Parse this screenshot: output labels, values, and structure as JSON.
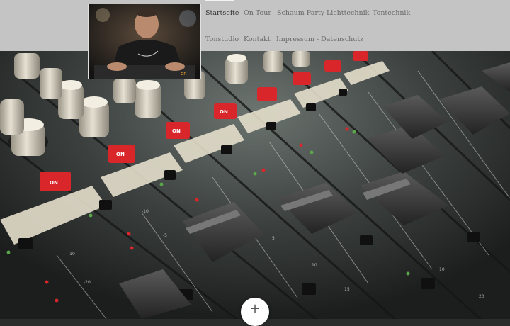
{
  "nav": {
    "items": [
      {
        "label": "Startseite",
        "active": true
      },
      {
        "label": "On Tour"
      },
      {
        "label": "Schaum Party"
      },
      {
        "label": "Lichttechnik"
      },
      {
        "label": "Tontechnik"
      },
      {
        "label": "Tonstudio"
      },
      {
        "label": "Kontakt"
      },
      {
        "label": "Impressum - Datenschutz"
      }
    ]
  },
  "logo": {
    "alt": "DJ portrait at mixing desk"
  },
  "hero": {
    "alt": "Close-up of an audio mixing console"
  },
  "fab": {
    "icon": "plus-icon",
    "symbol": "+"
  },
  "colors": {
    "header_bg": "#c4c4c4",
    "nav_text": "#6b6b6b",
    "nav_active": "#333333",
    "on_button": "#d9262b"
  }
}
